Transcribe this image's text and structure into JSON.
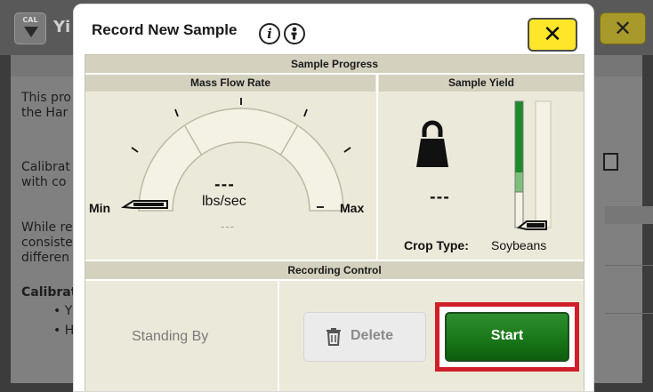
{
  "background": {
    "cal_label": "CAL",
    "title_fragment": "Yi",
    "close_label": "✕",
    "lines": [
      "This pro",
      "the Har",
      "Calibrat",
      "with co",
      "While re",
      "consiste",
      "differen",
      "Calibrat",
      "• Y",
      "• H"
    ]
  },
  "modal": {
    "title": "Record New Sample",
    "info_icon_1": "i",
    "info_icon_2": "i",
    "close_label": "✕"
  },
  "sample_progress": {
    "header": "Sample Progress",
    "mass_flow": {
      "header": "Mass Flow Rate",
      "min_label": "Min",
      "max_label": "Max",
      "value": "---",
      "unit": "lbs/sec",
      "sub_value": "---",
      "needle_level": 0
    },
    "sample_yield": {
      "header": "Sample Yield",
      "value": "---",
      "crop_type_label": "Crop Type:",
      "crop_type_value": "Soybeans",
      "bar_level": 0
    }
  },
  "recording_control": {
    "header": "Recording Control",
    "status": "Standing By",
    "delete_label": "Delete",
    "start_label": "Start"
  },
  "colors": {
    "accent_yellow": "#ffe628",
    "start_green": "#1b7a1b",
    "highlight_red": "#d01f2a",
    "panel_bg": "#ebe9d9",
    "header_bg": "#d4d1bf",
    "bar_green_dark": "#1f8a2a",
    "bar_green_light": "#7cc07c"
  }
}
